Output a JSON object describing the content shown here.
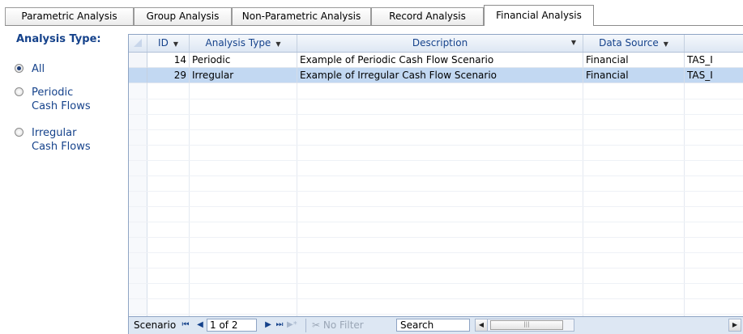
{
  "tabs": [
    {
      "label": "Parametric Analysis",
      "active": false
    },
    {
      "label": "Group Analysis",
      "active": false
    },
    {
      "label": "Non-Parametric Analysis",
      "active": false
    },
    {
      "label": "Record Analysis",
      "active": false
    },
    {
      "label": "Financial Analysis",
      "active": true
    }
  ],
  "panel": {
    "title": "Analysis Type:",
    "options": [
      {
        "label": "All",
        "checked": true
      },
      {
        "label": "Periodic Cash Flows",
        "line1": "Periodic",
        "line2": "Cash Flows",
        "checked": false
      },
      {
        "label": "Irregular Cash Flows",
        "line1": "Irregular",
        "line2": "Cash Flows",
        "checked": false
      }
    ]
  },
  "grid": {
    "columns": [
      "ID",
      "Analysis Type",
      "Description",
      "Data Source",
      ""
    ],
    "rows": [
      {
        "id": "14",
        "type": "Periodic",
        "description": "Example of Periodic Cash Flow Scenario",
        "source": "Financial",
        "extra": "TAS_I"
      },
      {
        "id": "29",
        "type": "Irregular",
        "description": "Example of Irregular Cash Flow Scenario",
        "source": "Financial",
        "extra": "TAS_I"
      }
    ],
    "selected_row_index": 1
  },
  "navbar": {
    "label": "Scenario",
    "record": "1 of 2",
    "filter": "No Filter",
    "search": "Search"
  },
  "colors": {
    "accent": "#15428b",
    "selection": "#c2d8f2",
    "header_bg": "#dde7f3"
  }
}
